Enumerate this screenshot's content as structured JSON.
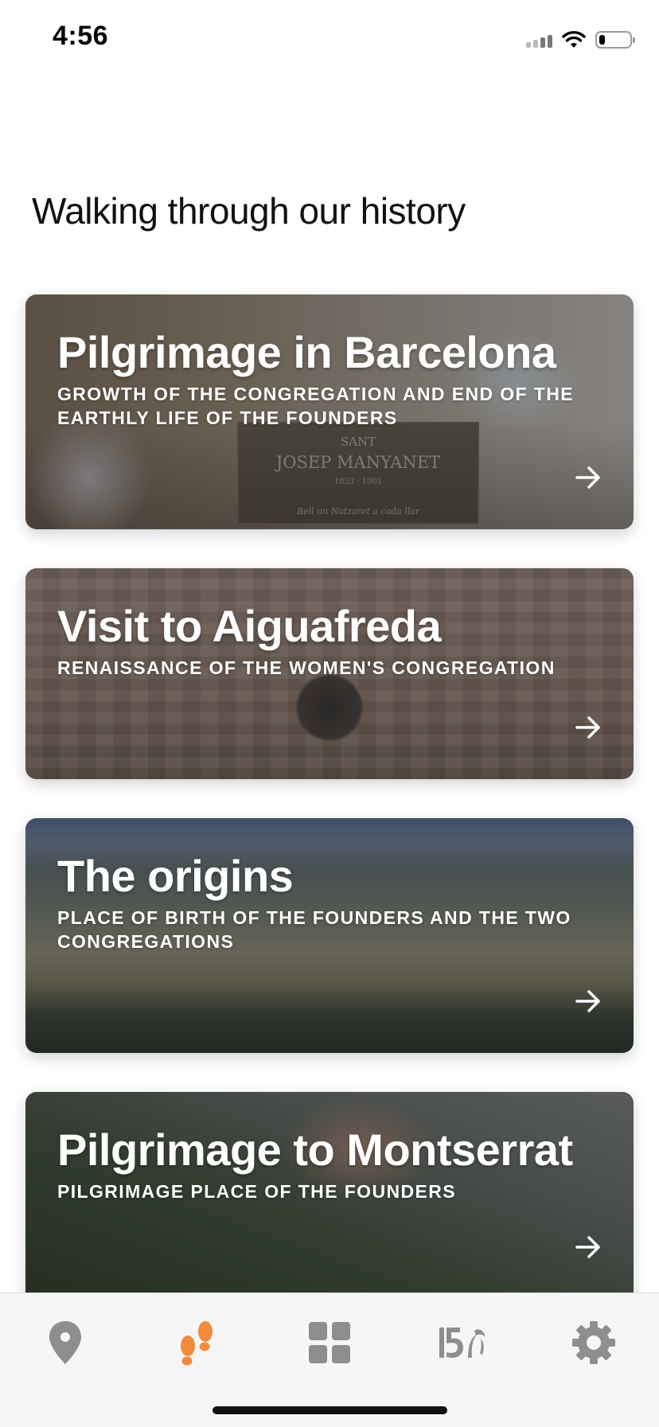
{
  "status_bar": {
    "time": "4:56",
    "battery_level": 0.2
  },
  "page": {
    "title": "Walking through our history"
  },
  "routes": [
    {
      "title": "Pilgrimage in Barcelona",
      "subtitle": "GROWTH OF THE CONGREGATION AND END OF THE EARTHLY LIFE OF THE FOUNDERS",
      "plaque_text": [
        "SANT",
        "JOSEP MANYANET",
        "1833 · 1901",
        "Bell un Natzaret a cada llar"
      ]
    },
    {
      "title": "Visit to Aiguafreda",
      "subtitle": "RENAISSANCE OF THE WOMEN'S CONGREGATION"
    },
    {
      "title": "The origins",
      "subtitle": "PLACE OF BIRTH OF THE FOUNDERS AND THE TWO CONGREGATIONS"
    },
    {
      "title": "Pilgrimage to Montserrat",
      "subtitle": "PILGRIMAGE PLACE OF THE FOUNDERS"
    }
  ],
  "tab_bar": {
    "active_color": "#f28b3c",
    "inactive_color": "#8e8e8e",
    "tabs": [
      {
        "icon": "map-pin-icon",
        "active": false
      },
      {
        "icon": "footprints-icon",
        "active": true
      },
      {
        "icon": "grid-icon",
        "active": false
      },
      {
        "icon": "anniversary-150-icon",
        "active": false
      },
      {
        "icon": "gear-icon",
        "active": false
      }
    ]
  }
}
